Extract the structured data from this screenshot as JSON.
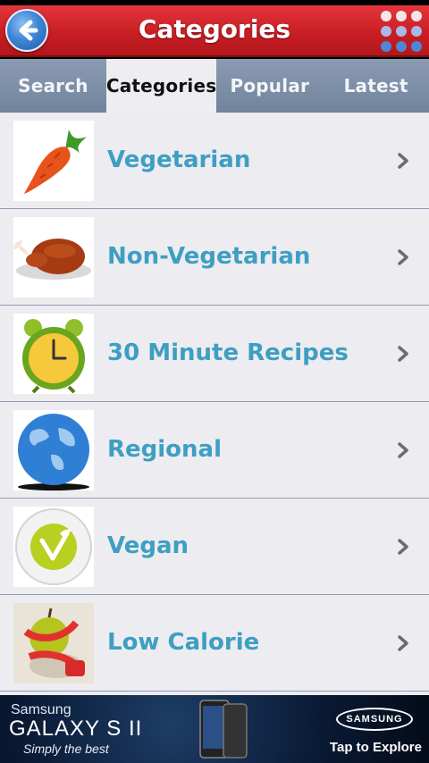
{
  "header": {
    "title": "Categories",
    "back_icon": "back-arrow-icon",
    "menu_icon": "grid-menu-icon"
  },
  "tabs": [
    {
      "label": "Search",
      "active": false
    },
    {
      "label": "Categories",
      "active": true
    },
    {
      "label": "Popular",
      "active": false
    },
    {
      "label": "Latest",
      "active": false
    }
  ],
  "categories": [
    {
      "label": "Vegetarian",
      "icon": "carrot-icon"
    },
    {
      "label": "Non-Vegetarian",
      "icon": "roast-chicken-icon"
    },
    {
      "label": "30 Minute Recipes",
      "icon": "alarm-clock-icon"
    },
    {
      "label": "Regional",
      "icon": "globe-icon"
    },
    {
      "label": "Vegan",
      "icon": "vegan-leaf-icon"
    },
    {
      "label": "Low Calorie",
      "icon": "apple-measuring-tape-icon"
    }
  ],
  "ad": {
    "brand": "Samsung",
    "model": "GALAXY S II",
    "tagline": "Simply the best",
    "logo": "SAMSUNG",
    "cta": "Tap to Explore"
  },
  "colors": {
    "header_red": "#c81f25",
    "tab_bar": "#7d8fa8",
    "active_tab": "#eeedf2",
    "category_text": "#3d9fc2",
    "list_bg": "#edecf1"
  }
}
